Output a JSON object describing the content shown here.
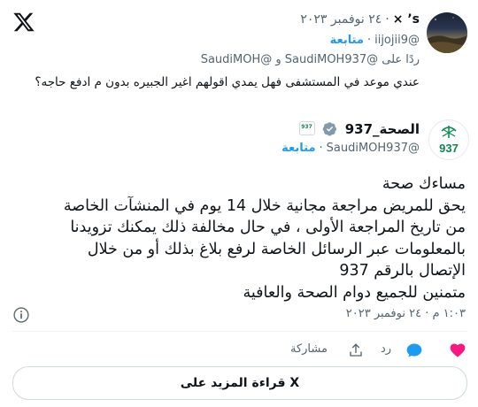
{
  "header": {
    "x_logo_icon": "x-logo-icon",
    "close": "x"
  },
  "reply": {
    "display_name": "s’ ×",
    "date": "٢٤ نوفمبر ٢٠٢٣",
    "handle": "@iijojii9",
    "follow_label": "متابعة",
    "replying_to_prefix": "ردًا على",
    "replying_to_accounts": "@SaudiMOH937 و @SaudiMOH",
    "text": "عندي موعد في المستشفى فهل يمدي اقولهم اغير الجبيره بدون م ادفع حاجه؟"
  },
  "tweet": {
    "display_name": "الصحة_937",
    "badge_text": "937",
    "handle": "@SaudiMOH937",
    "follow_label": "متابعة",
    "avatar_text": "937",
    "lines": [
      "مساءك صحة",
      "يحق للمريض مراجعة مجانية خلال 14 يوم في المنشآت الخاصة",
      "من تاريخ المراجعة الأولى ، في حال مخالفة ذلك يمكنك تزويدنا",
      "بالمعلومات عبر الرسائل الخاصة لرفع بلاغ بذلك أو من خلال",
      "الإتصال بالرقم 937",
      "متمنين للجميع دوام الصحة والعافية"
    ],
    "timestamp": "١:٠٣ م · ٢٤ نوفمبر ٢٠٢٣"
  },
  "actions": {
    "like_icon": "heart-icon",
    "reply_label": "رد",
    "share_label": "مشاركة"
  },
  "read_more": "قراءة المزيد على X",
  "colors": {
    "accent": "#1d9bf0",
    "like": "#f91880",
    "moh_green": "#0b8a4b"
  }
}
